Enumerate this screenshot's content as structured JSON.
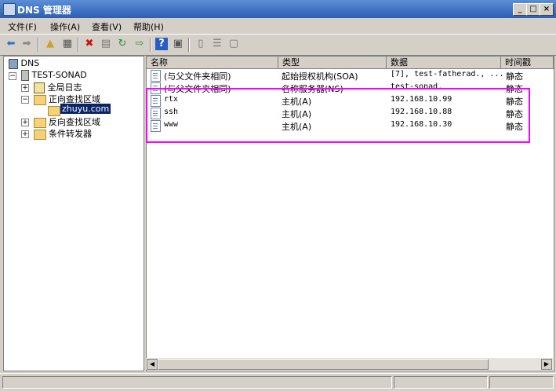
{
  "window": {
    "title": "DNS 管理器"
  },
  "menu": [
    "文件(F)",
    "操作(A)",
    "查看(V)",
    "帮助(H)"
  ],
  "tree": {
    "root": "DNS",
    "server": "TEST-SONAD",
    "global_logs": "全局日志",
    "forward_zones": "正向查找区域",
    "zone": "zhuyu.com",
    "reverse_zones": "反向查找区域",
    "conditional_forwarders": "条件转发器"
  },
  "list": {
    "columns": [
      "名称",
      "类型",
      "数据",
      "时间戳"
    ],
    "rows": [
      {
        "name": "(与父文件夹相同)",
        "type": "起始授权机构(SOA)",
        "data": "[7], test-fatherad., ...",
        "timestamp": "静态"
      },
      {
        "name": "(与父文件夹相同)",
        "type": "名称服务器(NS)",
        "data": "test-sonad.",
        "timestamp": "静态"
      },
      {
        "name": "rtx",
        "type": "主机(A)",
        "data": "192.168.10.99",
        "timestamp": "静态"
      },
      {
        "name": "ssh",
        "type": "主机(A)",
        "data": "192.168.10.88",
        "timestamp": "静态"
      },
      {
        "name": "www",
        "type": "主机(A)",
        "data": "192.168.10.30",
        "timestamp": "静态"
      }
    ]
  },
  "toolbar_icons": [
    "back-arrow-icon",
    "forward-arrow-icon",
    "up-folder-icon",
    "show-hide-tree-icon",
    "delete-icon",
    "properties-icon",
    "refresh-icon",
    "export-icon",
    "help-icon",
    "console-icon",
    "server-icon",
    "list-icon",
    "record-icon"
  ],
  "highlight_color": "#ff00ff"
}
